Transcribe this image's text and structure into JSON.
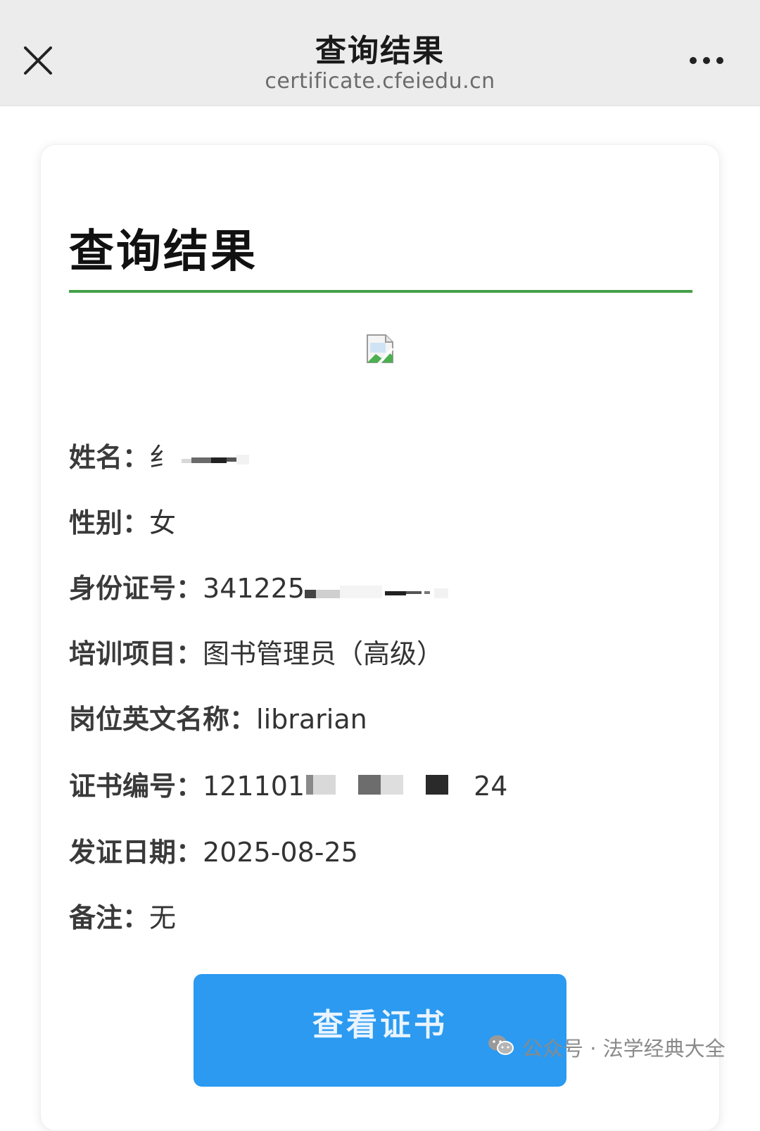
{
  "nav": {
    "title": "查询结果",
    "domain": "certificate.cfeiedu.cn"
  },
  "card": {
    "title": "查询结果",
    "accent_color": "#43a047"
  },
  "fields": [
    {
      "label": "姓名：",
      "value": "纟"
    },
    {
      "label": "性别：",
      "value": "女"
    },
    {
      "label": "身份证号：",
      "value": "341225"
    },
    {
      "label": "培训项目：",
      "value": "图书管理员（高级）"
    },
    {
      "label": "岗位英文名称：",
      "value": "librarian"
    },
    {
      "label": "证书编号：",
      "value": "121101",
      "suffix": "24"
    },
    {
      "label": "发证日期：",
      "value": "2025-08-25"
    },
    {
      "label": "备注：",
      "value": "无"
    }
  ],
  "button": {
    "label": "查看证书",
    "color": "#2b9af0"
  },
  "watermark": {
    "text": "公众号 · 法学经典大全"
  }
}
